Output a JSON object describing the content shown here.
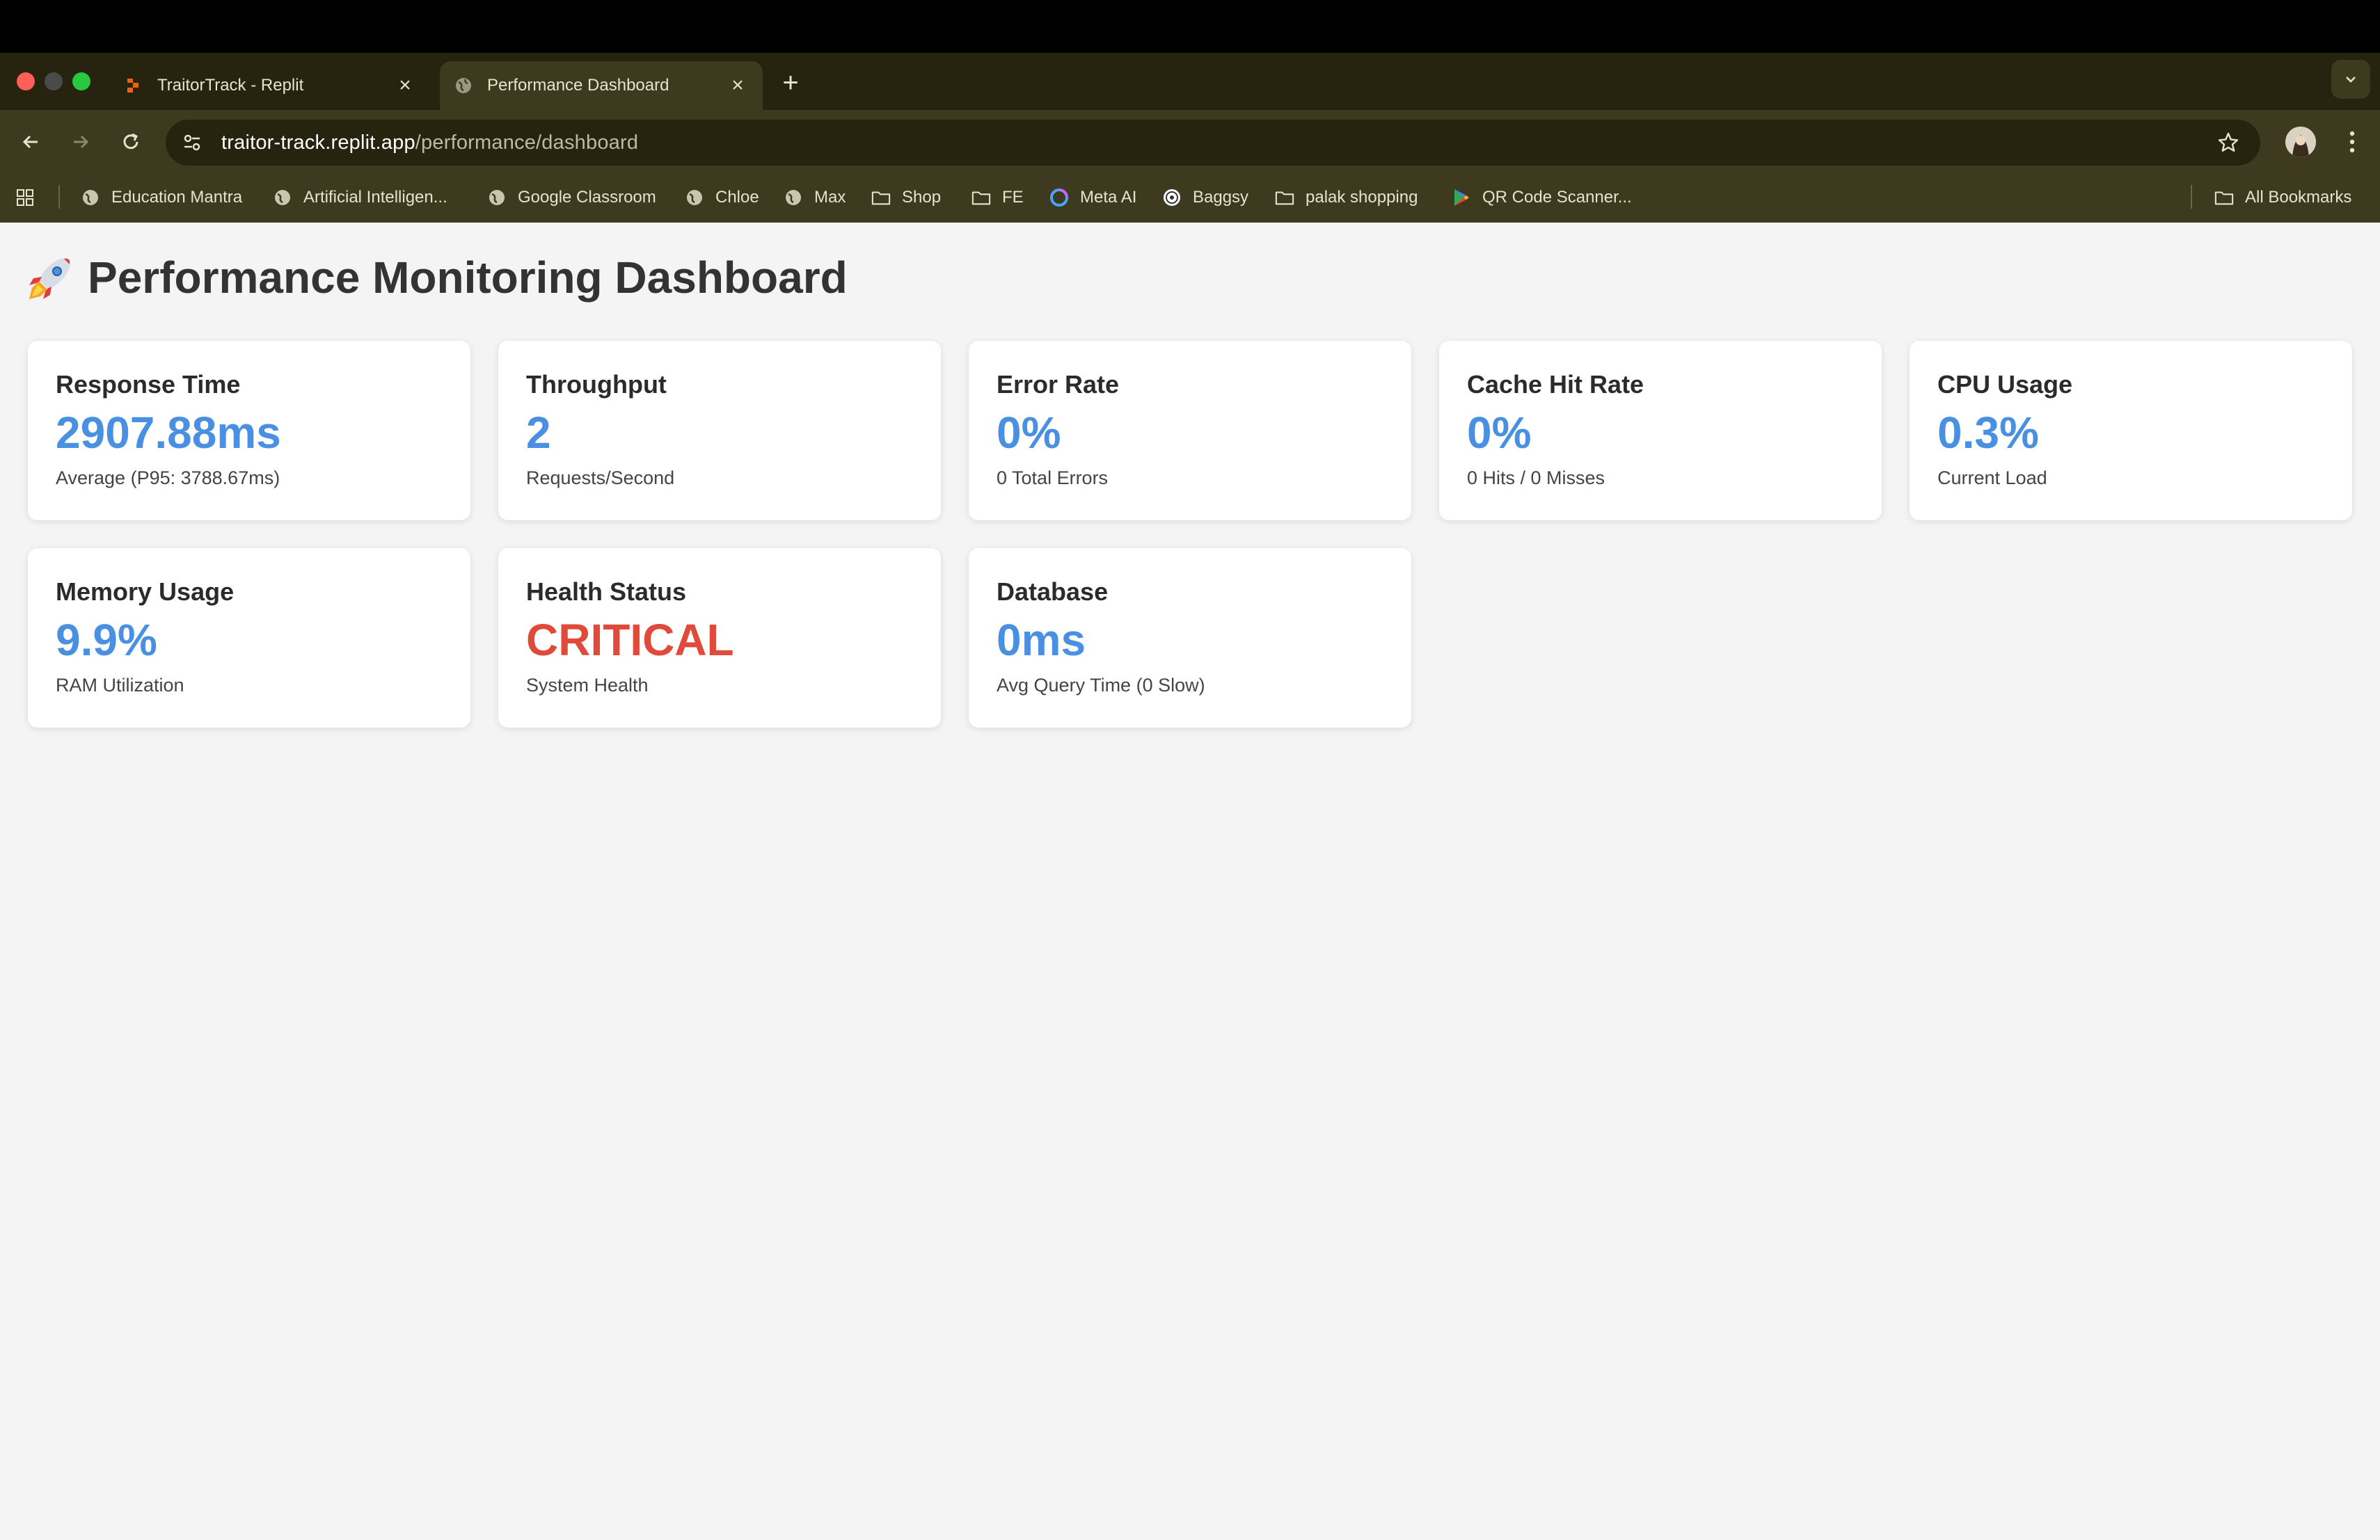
{
  "browser": {
    "tabs": [
      {
        "title": "TraitorTrack - Replit",
        "active": false,
        "icon": "replit-icon"
      },
      {
        "title": "Performance Dashboard",
        "active": true,
        "icon": "globe-icon"
      }
    ],
    "url_host": "traitor-track.replit.app",
    "url_path": "/performance/dashboard",
    "bookmarks": [
      {
        "label": "Education Mantra",
        "icon": "globe-icon"
      },
      {
        "label": "Artificial Intelligen...",
        "icon": "globe-icon"
      },
      {
        "label": "Google Classroom",
        "icon": "globe-icon"
      },
      {
        "label": "Chloe",
        "icon": "globe-icon"
      },
      {
        "label": "Max",
        "icon": "globe-icon"
      },
      {
        "label": "Shop",
        "icon": "folder-icon"
      },
      {
        "label": "FE",
        "icon": "folder-icon"
      },
      {
        "label": "Meta AI",
        "icon": "meta-ai-icon"
      },
      {
        "label": "Baggsy",
        "icon": "baggsy-icon"
      },
      {
        "label": "palak shopping",
        "icon": "folder-icon"
      },
      {
        "label": "QR Code Scanner...",
        "icon": "play-store-icon"
      }
    ],
    "all_bookmarks": "All Bookmarks"
  },
  "page": {
    "title": "Performance Monitoring Dashboard",
    "title_icon": "rocket-icon"
  },
  "metrics": [
    {
      "label": "Response Time",
      "value": "2907.88ms",
      "sub": "Average (P95: 3788.67ms)"
    },
    {
      "label": "Throughput",
      "value": "2",
      "sub": "Requests/Second"
    },
    {
      "label": "Error Rate",
      "value": "0%",
      "sub": "0 Total Errors"
    },
    {
      "label": "Cache Hit Rate",
      "value": "0%",
      "sub": "0 Hits / 0 Misses"
    },
    {
      "label": "CPU Usage",
      "value": "0.3%",
      "sub": "Current Load"
    },
    {
      "label": "Memory Usage",
      "value": "9.9%",
      "sub": "RAM Utilization"
    },
    {
      "label": "Health Status",
      "value": "CRITICAL",
      "sub": "System Health"
    },
    {
      "label": "Database",
      "value": "0ms",
      "sub": "Avg Query Time (0 Slow)"
    }
  ],
  "colors": {
    "value_blue": "#4a90e2",
    "critical_red": "#e04a3a",
    "chrome_dark": "#26240f",
    "chrome_toolbar": "#3d3a20"
  }
}
